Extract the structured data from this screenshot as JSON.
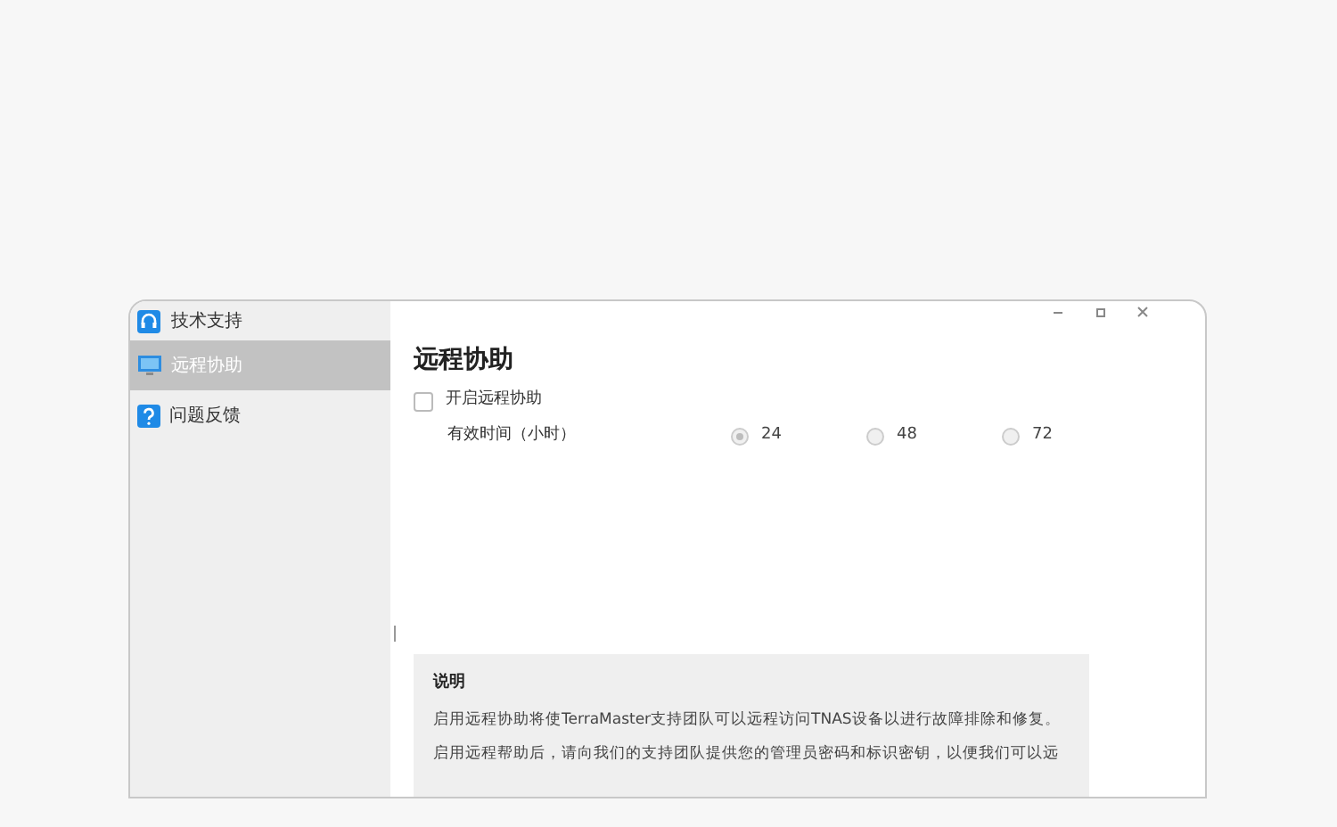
{
  "window": {
    "title": "技术支持"
  },
  "sidebar": {
    "items": [
      {
        "label": "远程协助",
        "selected": true,
        "kind": "monitor"
      },
      {
        "label": "问题反馈",
        "selected": false,
        "kind": "help"
      }
    ]
  },
  "content": {
    "title": "远程协助",
    "enable": {
      "label": "开启远程协助",
      "checked": false
    },
    "duration": {
      "label": "有效时间（小时）",
      "options": [
        {
          "label": "24",
          "selected": true
        },
        {
          "label": "48",
          "selected": false
        },
        {
          "label": "72",
          "selected": false
        }
      ]
    },
    "note": {
      "title": "说明",
      "lines": [
        "启用远程协助将使TerraMaster支持团队可以远程访问TNAS设备以进行故障排除和修复。",
        "启用远程帮助后，请向我们的支持团队提供您的管理员密码和标识密钥，以便我们可以远"
      ]
    }
  }
}
